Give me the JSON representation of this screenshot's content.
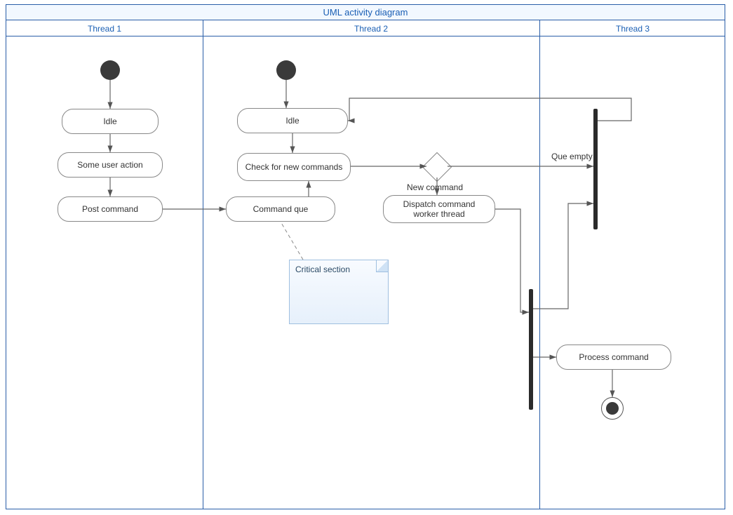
{
  "title": "UML activity diagram",
  "lanes": {
    "t1": "Thread 1",
    "t2": "Thread 2",
    "t3": "Thread 3"
  },
  "nodes": {
    "idle1": "Idle",
    "someUser": "Some user action",
    "postCmd": "Post command",
    "idle2": "Idle",
    "checkNew": "Check for new commands",
    "cmdQue": "Command que",
    "dispatch": "Dispatch command worker thread",
    "processCmd": "Process command"
  },
  "edgeLabels": {
    "queEmpty": "Que empty",
    "newCommand": "New command"
  },
  "note": "Critical section"
}
